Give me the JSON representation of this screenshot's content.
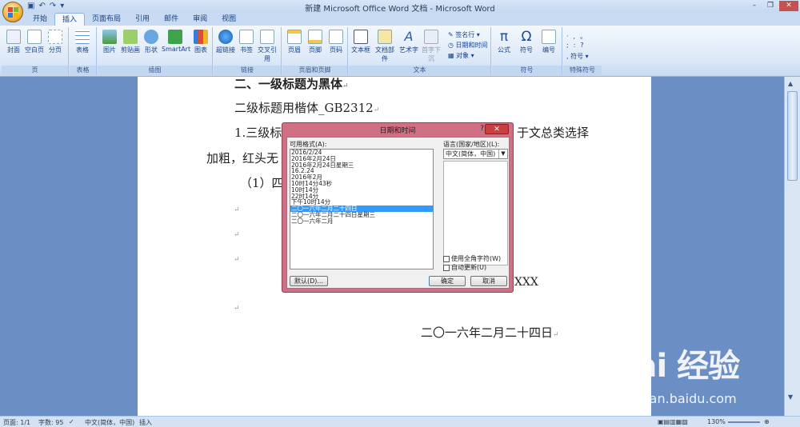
{
  "window": {
    "title": "新建 Microsoft Office Word 文档 - Microsoft Word"
  },
  "ribbon": {
    "tabs": [
      "开始",
      "插入",
      "页面布局",
      "引用",
      "邮件",
      "审阅",
      "视图"
    ],
    "active_tab": "插入",
    "groups": [
      {
        "label": "页",
        "buttons": [
          "封面",
          "空白页",
          "分页"
        ]
      },
      {
        "label": "表格",
        "buttons": [
          "表格"
        ]
      },
      {
        "label": "插图",
        "buttons": [
          "图片",
          "剪贴画",
          "形状",
          "SmartArt",
          "图表"
        ]
      },
      {
        "label": "链接",
        "buttons": [
          "超链接",
          "书签",
          "交叉引用"
        ]
      },
      {
        "label": "页眉和页脚",
        "buttons": [
          "页眉",
          "页脚",
          "页码"
        ]
      },
      {
        "label": "文本",
        "buttons": [
          "文本框",
          "文档部件",
          "艺术字",
          "首字下沉"
        ]
      },
      {
        "label": "符号",
        "buttons": [
          "公式",
          "符号",
          "编号"
        ]
      },
      {
        "label": "特殊符号",
        "buttons": [
          "符号"
        ]
      }
    ],
    "text_small": [
      "签名行",
      "日期和时间",
      "对象"
    ]
  },
  "document": {
    "line1": "二、一级标题为黑体",
    "line2": "二级标题用楷体_GB2312",
    "line3a": "1.三级标",
    "line3b": "于文总类选择",
    "line4": "加粗，红头无",
    "line5": "（1）四",
    "line_x": "XXX",
    "date": "二〇一六年二月二十四日"
  },
  "dialog": {
    "title": "日期和时间",
    "help": "?",
    "close": "✕",
    "formats_label": "可用格式(A):",
    "formats": [
      "2016/2/24",
      "2016年2月24日",
      "2016年2月24日星期三",
      "16.2.24",
      "2016年2月",
      "10时14分43秒",
      "10时14分",
      "22时14分",
      "下午10时14分",
      "二〇一六年二月二十四日",
      "二〇一六年二月二十四日星期三",
      "二〇一六年二月"
    ],
    "selected_index": 9,
    "language_label": "语言(国家/地区)(L):",
    "language_value": "中文(简体，中国)",
    "check_fullwidth": "使用全角字符(W)",
    "check_autoupdate": "自动更新(U)",
    "btn_default": "默认(D)...",
    "btn_ok": "确定",
    "btn_cancel": "取消"
  },
  "statusbar": {
    "page": "页面: 1/1",
    "words": "字数: 95",
    "language": "中文(简体，中国)",
    "mode": "插入",
    "zoom": "130%"
  },
  "watermark": {
    "logo": "Bai 经验",
    "url": "jingyan.baidu.com"
  }
}
